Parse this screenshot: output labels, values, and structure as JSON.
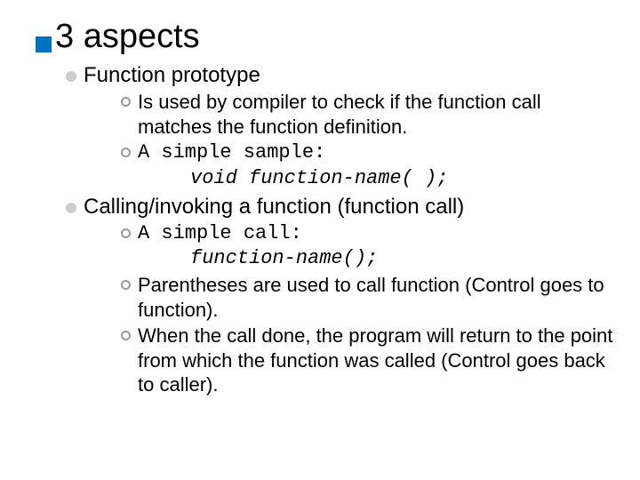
{
  "title": "3 aspects",
  "section1": {
    "heading": "Function prototype",
    "items": [
      {
        "text": "Is used by compiler to check if the function call matches the function definition."
      },
      {
        "prefix": "A simple sample:",
        "code": "void function-name( );"
      }
    ]
  },
  "section2": {
    "heading": "Calling/invoking a function (function call)",
    "items": [
      {
        "prefix": "A simple call:",
        "code": "function-name();"
      },
      {
        "text": "Parentheses are used to call function (Control goes to function)."
      },
      {
        "text": "When the call done, the program will return to the point from which the function was called (Control goes back to caller)."
      }
    ]
  }
}
